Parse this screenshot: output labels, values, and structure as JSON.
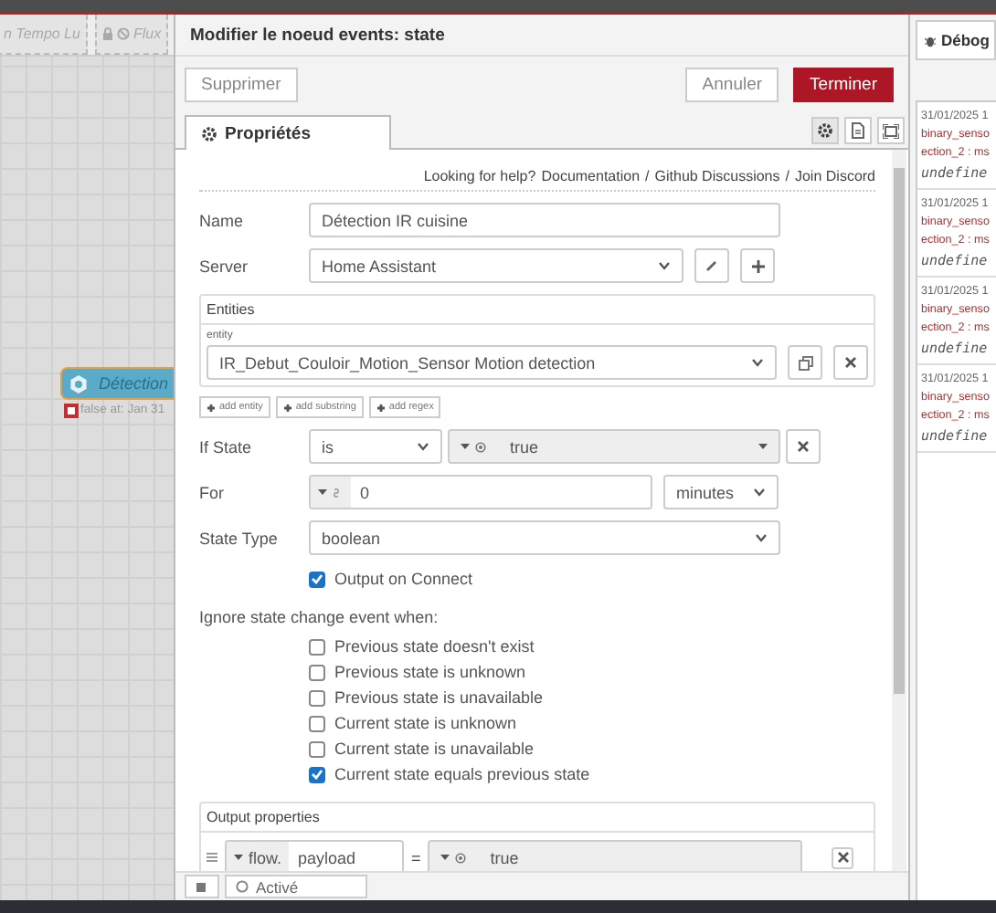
{
  "workspace_tabs": [
    {
      "label": "n Tempo Lu",
      "kind": "plain"
    },
    {
      "label": "Flux",
      "kind": "locked"
    }
  ],
  "node": {
    "label": "Détection",
    "status": "false at: Jan 31"
  },
  "editor": {
    "title": "Modifier le noeud events: state",
    "delete_button": "Supprimer",
    "cancel_button": "Annuler",
    "done_button": "Terminer",
    "tabs": [
      {
        "label": "Propriétés",
        "selected": true
      }
    ],
    "help": {
      "prefix": "Looking for help?",
      "links": [
        "Documentation",
        "Github Discussions",
        "Join Discord"
      ],
      "separators": [
        "/",
        "/"
      ]
    },
    "name": {
      "label": "Name",
      "value": "Détection IR cuisine"
    },
    "server": {
      "label": "Server",
      "value": "Home Assistant"
    },
    "entities": {
      "title": "Entities",
      "entity_label": "entity",
      "value": "IR_Debut_Couloir_Motion_Sensor Motion detection",
      "add_buttons": [
        "add entity",
        "add substring",
        "add regex"
      ]
    },
    "if_state": {
      "label": "If State",
      "operator": "is",
      "value": "true"
    },
    "for": {
      "label": "For",
      "value": "0",
      "unit": "minutes"
    },
    "state_type": {
      "label": "State Type",
      "value": "boolean"
    },
    "output_on_connect": {
      "label": "Output on Connect",
      "checked": true
    },
    "ignore": {
      "title": "Ignore state change event when:",
      "options": [
        {
          "label": "Previous state doesn't exist",
          "checked": false
        },
        {
          "label": "Previous state is unknown",
          "checked": false
        },
        {
          "label": "Previous state is unavailable",
          "checked": false
        },
        {
          "label": "Current state is unknown",
          "checked": false
        },
        {
          "label": "Current state is unavailable",
          "checked": false
        },
        {
          "label": "Current state equals previous state",
          "checked": true
        }
      ]
    },
    "output_properties": {
      "title": "Output properties",
      "rows": [
        {
          "property_type": "flow.",
          "property": "payload",
          "assign_sign": "=",
          "value": "true"
        }
      ]
    },
    "footer": {
      "status": "Activé"
    }
  },
  "debug": {
    "tab": "Débog",
    "messages": [
      {
        "time": "31/01/2025 1",
        "topic": "binary_senso",
        "path": "ection_2 : ms",
        "value": "undefine"
      },
      {
        "time": "31/01/2025 1",
        "topic": "binary_senso",
        "path": "ection_2 : ms",
        "value": "undefine"
      },
      {
        "time": "31/01/2025 1",
        "topic": "binary_senso",
        "path": "ection_2 : ms",
        "value": "undefine"
      },
      {
        "time": "31/01/2025 1",
        "topic": "binary_senso",
        "path": "ection_2 : ms",
        "value": "undefine"
      }
    ]
  }
}
